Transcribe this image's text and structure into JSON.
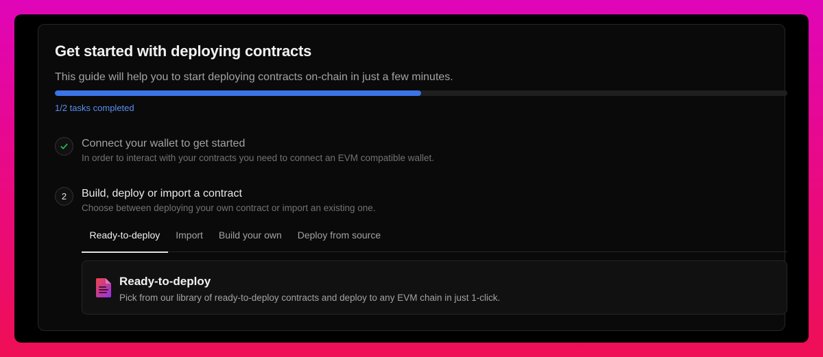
{
  "colors": {
    "accent": "#3b74e8",
    "check": "#22c55e",
    "card_bg": "#0a0a0a"
  },
  "header": {
    "title": "Get started with deploying contracts",
    "subtitle": "This guide will help you to start deploying contracts on-chain in just a few minutes."
  },
  "progress": {
    "completed": 1,
    "total": 2,
    "fraction": 0.5,
    "label": "1/2 tasks completed"
  },
  "steps": [
    {
      "status": "done",
      "icon": "check-icon",
      "title": "Connect your wallet to get started",
      "description": "In order to interact with your contracts you need to connect an EVM compatible wallet."
    },
    {
      "status": "active",
      "number": "2",
      "title": "Build, deploy or import a contract",
      "description": "Choose between deploying your own contract or import an existing one."
    }
  ],
  "tabs": [
    {
      "label": "Ready-to-deploy",
      "active": true
    },
    {
      "label": "Import",
      "active": false
    },
    {
      "label": "Build your own",
      "active": false
    },
    {
      "label": "Deploy from source",
      "active": false
    }
  ],
  "option": {
    "icon": "document-icon",
    "title": "Ready-to-deploy",
    "description": "Pick from our library of ready-to-deploy contracts and deploy to any EVM chain in just 1-click."
  }
}
